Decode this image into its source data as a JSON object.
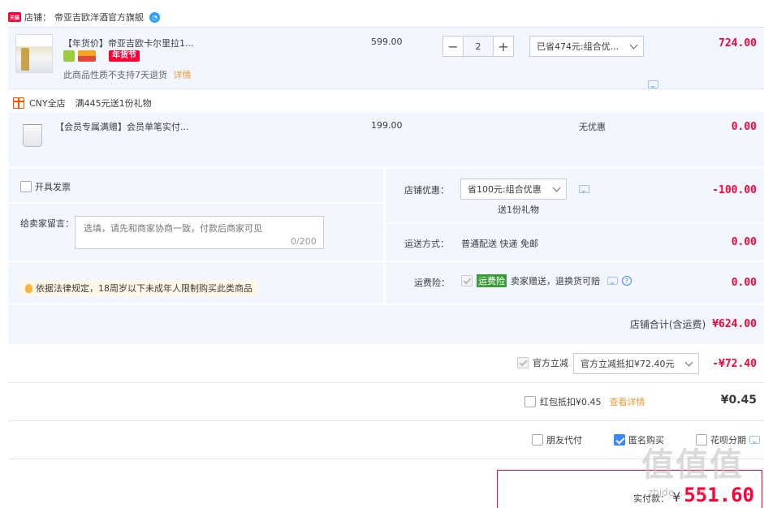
{
  "shop": {
    "label": "店铺：",
    "name": "帝亚吉欧洋酒官方旗舰",
    "badge": "天猫",
    "ww_icon": "wangwang-chat-icon"
  },
  "items": [
    {
      "title": "【年货价】帝亚吉欧卡尔里拉1...",
      "festival_tag": "年货节",
      "note": "此商品性质不支持7天退货",
      "note_link": "详情",
      "unit_price": "599.00",
      "quantity": "2",
      "promo_select": "已省474元:组合优...",
      "subtotal": "724.00"
    }
  ],
  "gift_section": {
    "header_store": "CNY全店",
    "header_promo": "满445元送1份礼物",
    "item_title": "【会员专属满赠】会员单笔实付...",
    "unit_price": "199.00",
    "promo_text": "无优惠",
    "subtotal": "0.00"
  },
  "options": {
    "invoice_label": "开具发票",
    "message_label": "给卖家留言：",
    "message_placeholder": "选填，请先和商家协商一致，付款后商家可见",
    "message_counter": "0/200",
    "legal_notice": "依据法律规定，18周岁以下未成年人限制购买此类商品"
  },
  "shop_discount": {
    "label": "店铺优惠：",
    "select": "省100元:组合优惠",
    "sub": "送1份礼物",
    "amount": "-100.00"
  },
  "shipping": {
    "label": "运送方式：",
    "value": "普通配送 快递 免邮",
    "amount": "0.00"
  },
  "freight_insurance": {
    "label": "运费险：",
    "tag": "运费险",
    "text": "卖家赠送，退换货可赔",
    "amount": "0.00"
  },
  "shop_total": {
    "label": "店铺合计(含运费)",
    "amount": "¥624.00"
  },
  "official_discount": {
    "label": "官方立减",
    "select": "官方立减抵扣¥72.40元",
    "amount": "-¥72.40"
  },
  "red_packet": {
    "label": "红包抵扣¥0.45",
    "link": "查看详情",
    "amount": "¥0.45"
  },
  "purchase_options": {
    "friend_pay": "朋友代付",
    "anonymous": "匿名购买",
    "huabei": "花呗分期"
  },
  "final": {
    "label": "实付款：",
    "currency": "¥",
    "amount": "551.60"
  },
  "watermark": {
    "text": "值值值",
    "sub": "zhide.......m"
  },
  "colors": {
    "accent_red": "#ff0036",
    "panel_blue": "#f2f7ff",
    "link_orange": "#f09a37",
    "checkbox_blue": "#3a87ff"
  }
}
